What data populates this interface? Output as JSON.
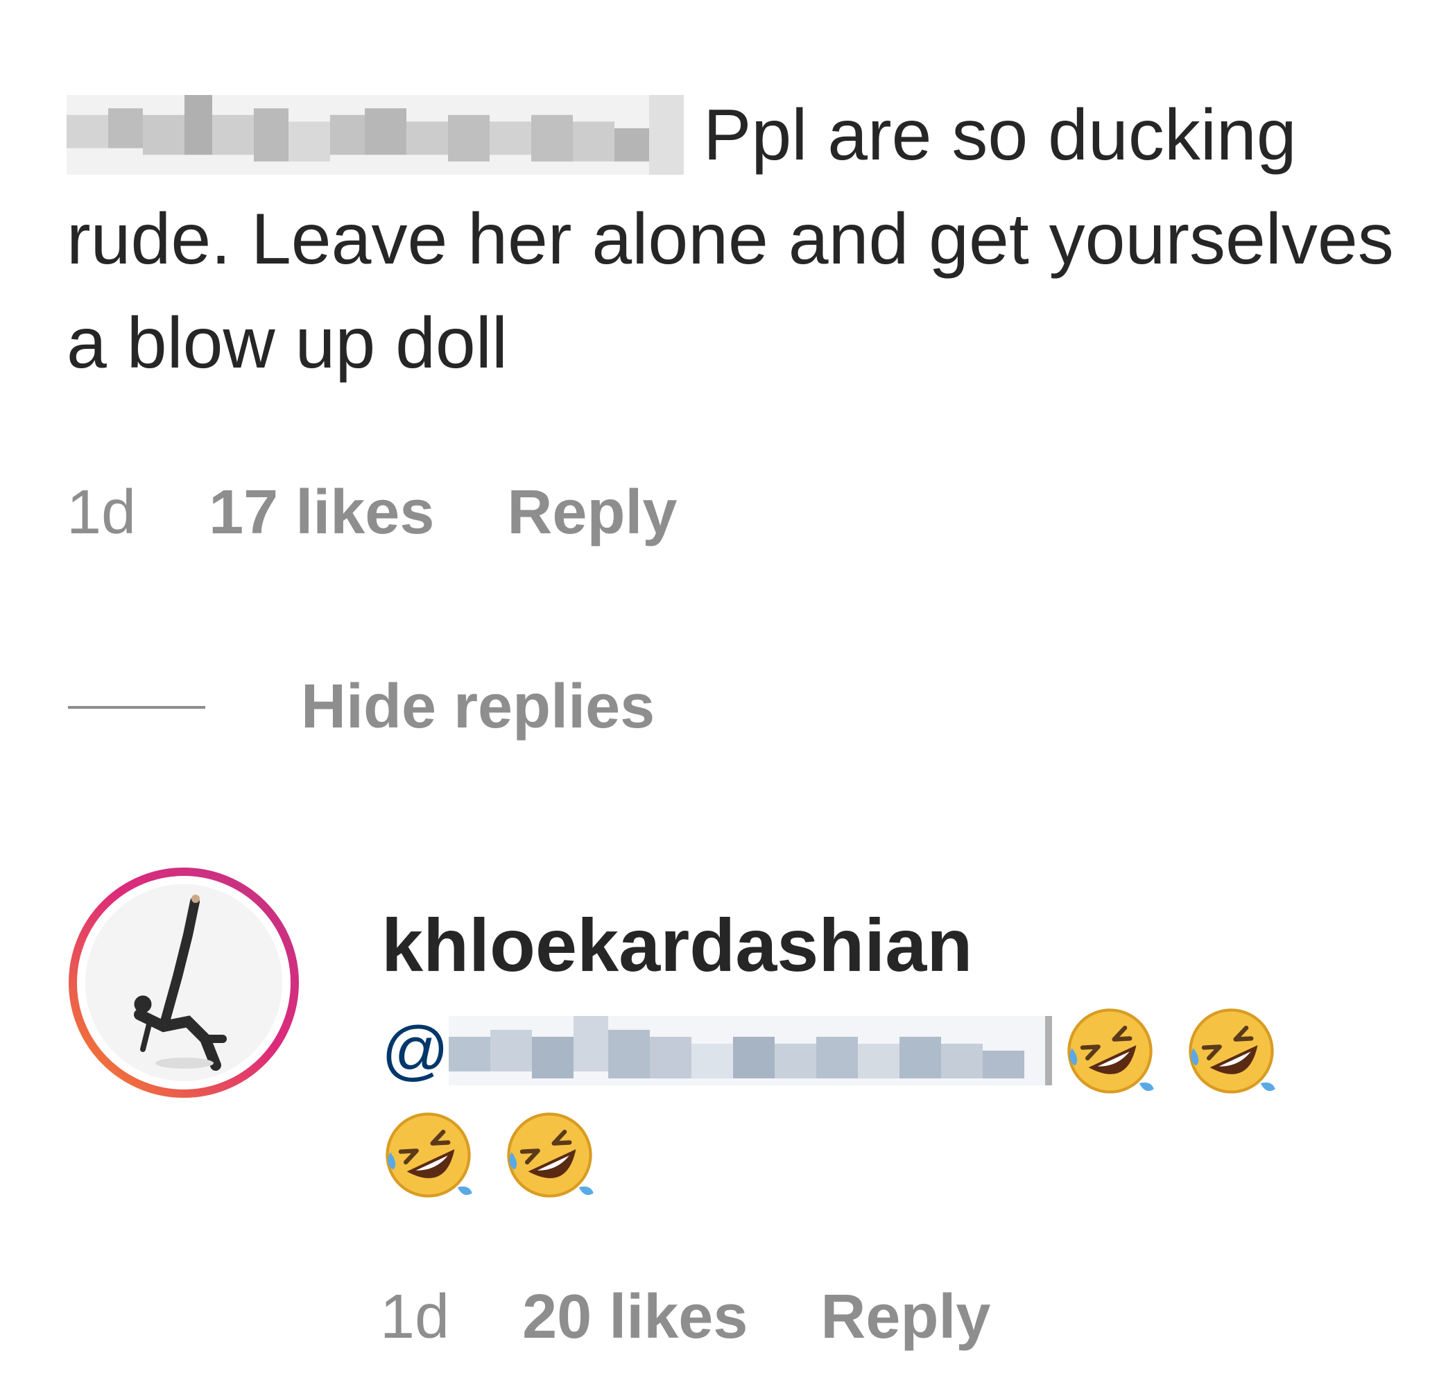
{
  "parent_comment": {
    "username_redacted": true,
    "text": "Ppl are so ducking rude. Leave her alone and get yourselves a blow up doll",
    "time": "1d",
    "likes": "17 likes",
    "reply_label": "Reply"
  },
  "replies_toggle": {
    "label": "Hide replies"
  },
  "reply": {
    "username": "khloekardashian",
    "mention_prefix": "@",
    "mention_redacted": true,
    "emoji": "rolling-on-the-floor-laughing",
    "emoji_count": 4,
    "time": "1d",
    "likes": "20 likes",
    "reply_label": "Reply"
  },
  "colors": {
    "text": "#262626",
    "meta": "#8e8e8e",
    "mention": "#00376b",
    "story_ring_start": "#f58529",
    "story_ring_end": "#c13584"
  }
}
